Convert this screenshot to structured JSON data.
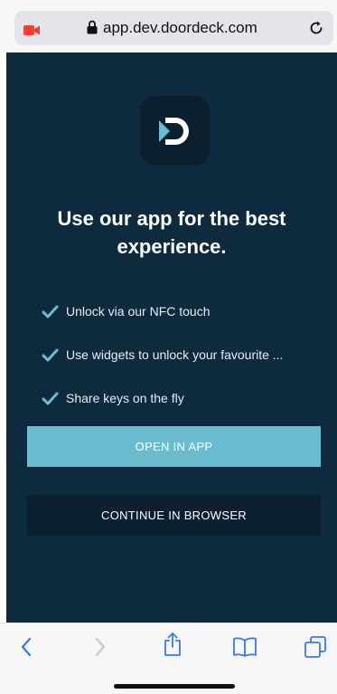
{
  "browser": {
    "url": "app.dev.doordeck.com",
    "icons": {
      "recording": "video-camera-icon",
      "lock": "lock-icon",
      "reload": "reload-icon"
    },
    "colors": {
      "recording": "#ff3b30",
      "toolbar_tint": "#3478f6"
    }
  },
  "page": {
    "logo_icon": "doordeck-logo-icon",
    "headline_line1": "Use our app for the best",
    "headline_line2": "experience.",
    "features": [
      {
        "icon": "check-icon",
        "text": "Unlock via our NFC touch"
      },
      {
        "icon": "check-icon",
        "text": "Use widgets to unlock your favourite ..."
      },
      {
        "icon": "check-icon",
        "text": "Share keys on the fly"
      }
    ],
    "open_in_app_label": "OPEN IN APP",
    "continue_in_browser_label": "CONTINUE IN BROWSER",
    "colors": {
      "background": "#0d2a3f",
      "accent": "#6bbccf",
      "secondary_button": "#0a2030"
    }
  },
  "toolbar": {
    "icons": [
      "back-icon",
      "forward-icon",
      "share-icon",
      "bookmarks-icon",
      "tabs-icon"
    ]
  }
}
